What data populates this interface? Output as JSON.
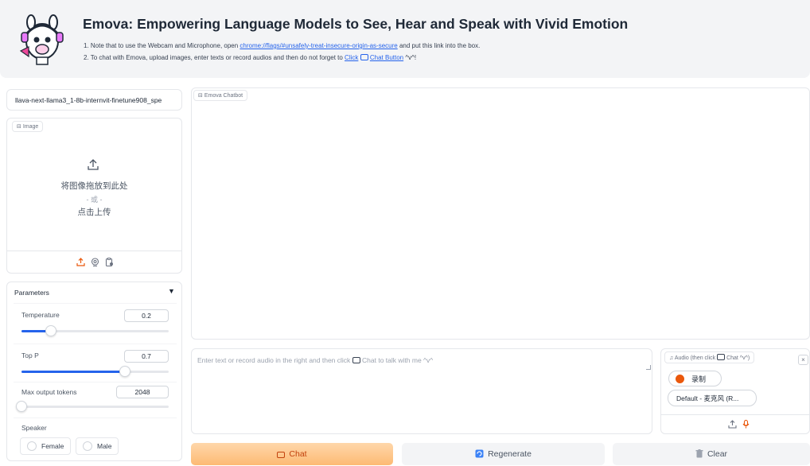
{
  "header": {
    "title": "Emova: Empowering Language Models to See, Hear and Speak with Vivid Emotion",
    "note1_prefix": "1. Note that to use the Webcam and Microphone, open ",
    "note1_link": "chrome://flags/#unsafely-treat-insecure-origin-as-secure",
    "note1_suffix": " and put this link into the box.",
    "note2_prefix": "2. To chat with Emova, upload images, enter texts or record audios and then do not forget to ",
    "note2_link": "Click",
    "note2_link2": "Chat Button",
    "note2_suffix": " ^v^!"
  },
  "model_select": {
    "value": "llava-next-llama3_1-8b-internvit-finetune908_spe"
  },
  "image_box": {
    "label": "Image",
    "drop_text": "将图像拖放到此处",
    "or_text": "- 或 -",
    "click_text": "点击上传"
  },
  "parameters": {
    "title": "Parameters",
    "temperature": {
      "label": "Temperature",
      "value": "0.2",
      "fraction": 0.2
    },
    "top_p": {
      "label": "Top P",
      "value": "0.7",
      "fraction": 0.7
    },
    "max_tokens": {
      "label": "Max output tokens",
      "value": "2048",
      "fraction": 0.0
    },
    "speaker": {
      "label": "Speaker",
      "options": [
        "Female",
        "Male"
      ]
    }
  },
  "chatbot": {
    "label": "Emova Chatbot"
  },
  "input": {
    "placeholder_prefix": "Enter text or record audio in the right and then click ",
    "placeholder_suffix": " Chat to talk with me ^v^"
  },
  "audio": {
    "label_prefix": "Audio (then click ",
    "label_suffix": " Chat ^v^)",
    "close": "×",
    "record_label": "录制",
    "mic_value": "Default - 麦克风 (R..."
  },
  "buttons": {
    "chat": "Chat",
    "regenerate": "Regenerate",
    "clear": "Clear"
  },
  "colors": {
    "accent": "#ea580c",
    "link": "#2563eb",
    "slider": "#2563eb",
    "chat_button": "#fdba74"
  }
}
